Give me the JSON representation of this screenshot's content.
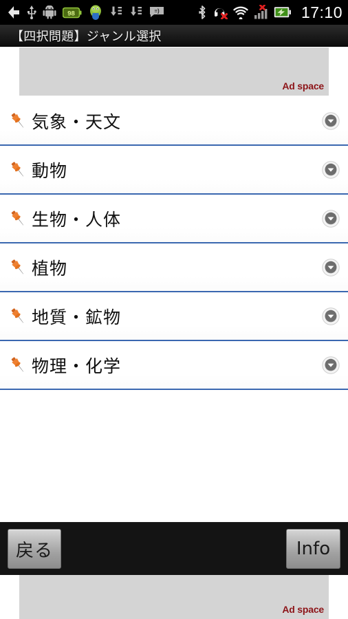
{
  "statusbar": {
    "time": "17:10",
    "left_icons": [
      {
        "name": "back-arrow-icon",
        "label": "back"
      },
      {
        "name": "usb-icon",
        "label": "usb"
      },
      {
        "name": "android-robot-icon",
        "label": "android"
      },
      {
        "name": "battery-level-badge",
        "label": "98"
      },
      {
        "name": "android-mascot-icon",
        "label": "android-mascot"
      },
      {
        "name": "download-list-icon",
        "label": "download"
      },
      {
        "name": "download-list-icon-2",
        "label": "download"
      },
      {
        "name": "sms-message-icon",
        "label": "message"
      }
    ],
    "right_icons": [
      {
        "name": "bluetooth-icon",
        "label": "bluetooth"
      },
      {
        "name": "headset-disabled-icon",
        "label": "headset-off"
      },
      {
        "name": "wifi-icon",
        "label": "wifi"
      },
      {
        "name": "signal-bars-icon",
        "label": "no-signal"
      },
      {
        "name": "battery-charging-icon",
        "label": "battery"
      }
    ]
  },
  "titlebar": {
    "title": "【四択問題】ジャンル選択"
  },
  "ads": {
    "top_label": "Ad space",
    "bottom_label": "Ad space"
  },
  "list": {
    "items": [
      {
        "label": "気象・天文",
        "icon": "pushpin-icon",
        "expander": "chevron-down-icon"
      },
      {
        "label": "動物",
        "icon": "pushpin-icon",
        "expander": "chevron-down-icon"
      },
      {
        "label": "生物・人体",
        "icon": "pushpin-icon",
        "expander": "chevron-down-icon"
      },
      {
        "label": "植物",
        "icon": "pushpin-icon",
        "expander": "chevron-down-icon"
      },
      {
        "label": "地質・鉱物",
        "icon": "pushpin-icon",
        "expander": "chevron-down-icon"
      },
      {
        "label": "物理・化学",
        "icon": "pushpin-icon",
        "expander": "chevron-down-icon"
      }
    ]
  },
  "bottombar": {
    "back_label": "戻る",
    "info_label": "Info"
  },
  "colors": {
    "separator_blue": "#3a67b0",
    "ad_label_red": "#8d1418",
    "ad_block_gray": "#d4d4d4",
    "pin_orange": "#e8762c",
    "titlebar_dark": "#1a1a1a"
  }
}
